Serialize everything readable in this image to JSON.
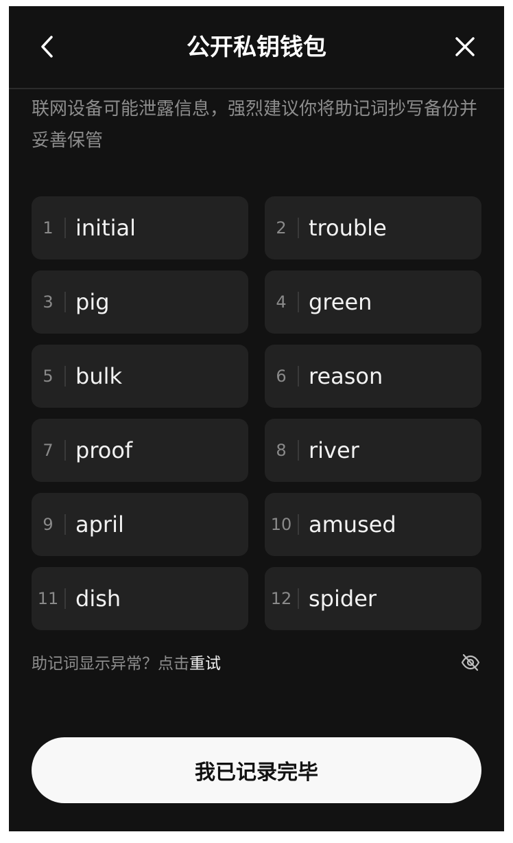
{
  "header": {
    "title": "公开私钥钱包",
    "back_icon": "chevron-left-icon",
    "close_icon": "close-icon"
  },
  "warning_text": "联网设备可能泄露信息，强烈建议你将助记词抄写备份并妥善保管",
  "mnemonic": [
    {
      "index": "1",
      "word": "initial"
    },
    {
      "index": "2",
      "word": "trouble"
    },
    {
      "index": "3",
      "word": "pig"
    },
    {
      "index": "4",
      "word": "green"
    },
    {
      "index": "5",
      "word": "bulk"
    },
    {
      "index": "6",
      "word": "reason"
    },
    {
      "index": "7",
      "word": "proof"
    },
    {
      "index": "8",
      "word": "river"
    },
    {
      "index": "9",
      "word": "april"
    },
    {
      "index": "10",
      "word": "amused"
    },
    {
      "index": "11",
      "word": "dish"
    },
    {
      "index": "12",
      "word": "spider"
    }
  ],
  "hint": {
    "text": "助记词显示异常？点击",
    "link": "重试"
  },
  "visibility_icon": "eye-off-icon",
  "confirm_button": "我已记录完毕",
  "colors": {
    "background": "#121212",
    "card": "#222222",
    "muted_text": "#8d8d8d",
    "primary_button": "#f8f8f8"
  }
}
